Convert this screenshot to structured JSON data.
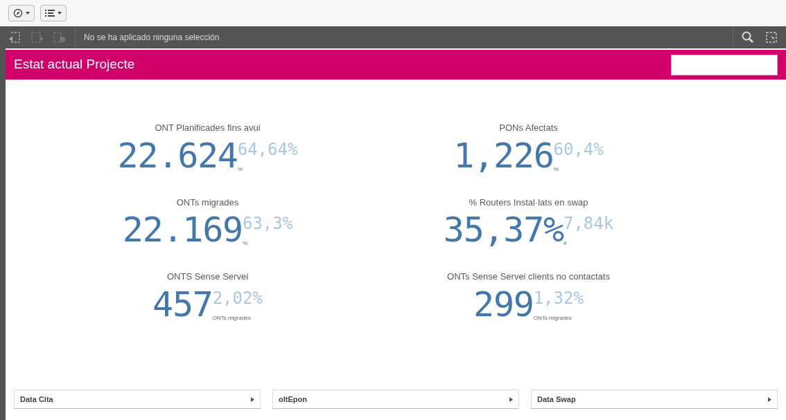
{
  "toolbar": {
    "buttons": [
      {
        "kind": "compass"
      },
      {
        "kind": "list"
      }
    ]
  },
  "selection_bar": {
    "text": "No se ha aplicado ninguna selección"
  },
  "sheet": {
    "title": "Estat actual Projecte"
  },
  "kpis": [
    {
      "title": "ONT Planificades fins avui",
      "value": "22.624",
      "secondary": "64,64%",
      "sublabel": "%"
    },
    {
      "title": "PONs Afectats",
      "value": "1,226",
      "secondary": "60,4%",
      "sublabel": "%"
    },
    {
      "title": "ONTs migrades",
      "value": "22.169",
      "secondary": "63,3%",
      "sublabel": "%"
    },
    {
      "title": "% Routers Instal·lats en swap",
      "value": "35,37%",
      "secondary": "7,84k",
      "sublabel": "#"
    },
    {
      "title": "ONTS Sense Servei",
      "value": "457",
      "secondary": "2,02%",
      "sublabel": "ONTs migrades"
    },
    {
      "title": "ONTs Sense Servei clients no contactats",
      "value": "299",
      "secondary": "1,32%",
      "sublabel": "ONTs migrades"
    }
  ],
  "filters": [
    {
      "label": "Data Cita"
    },
    {
      "label": "oltEpon"
    },
    {
      "label": "Data Swap"
    }
  ]
}
